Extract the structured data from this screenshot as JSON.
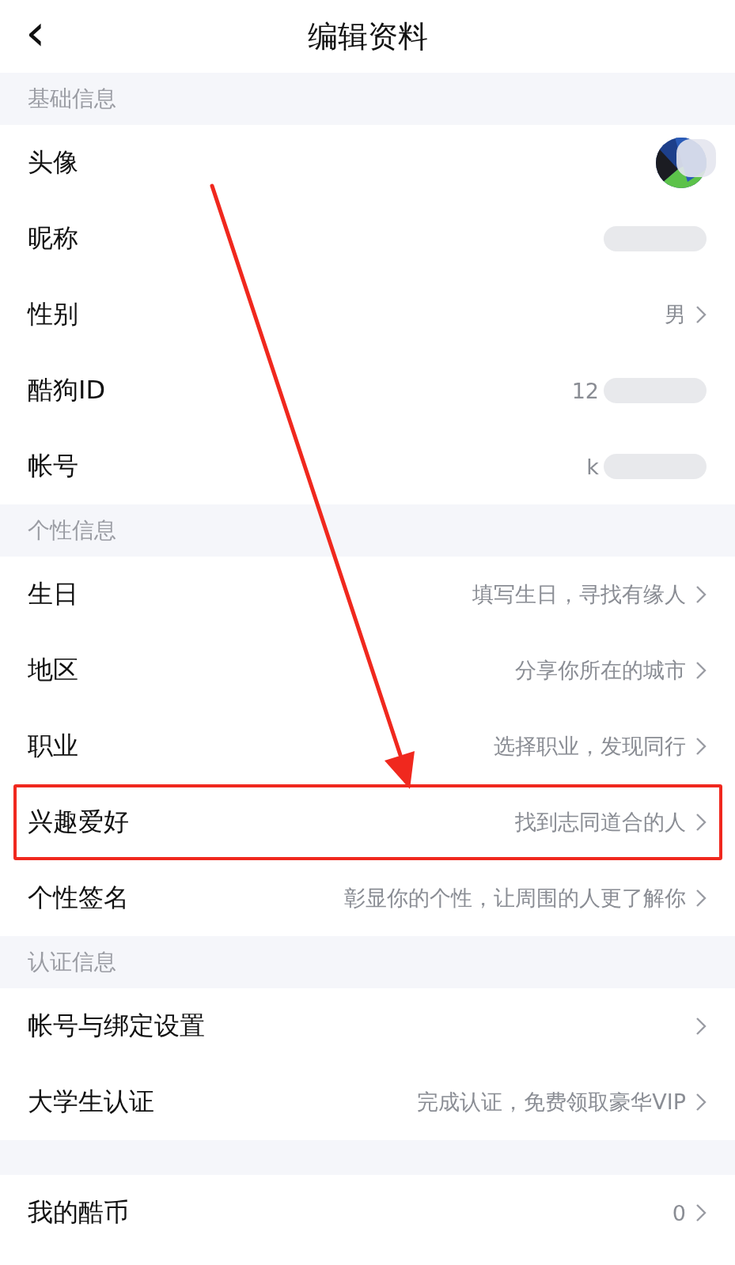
{
  "header": {
    "back_icon": "‹",
    "title": "编辑资料"
  },
  "sections": [
    {
      "title": "基础信息",
      "rows": [
        {
          "kind": "avatar",
          "label": "头像",
          "chevron": false,
          "redacted": true
        },
        {
          "kind": "value",
          "label": "昵称",
          "chevron": false,
          "redacted": true
        },
        {
          "kind": "value",
          "label": "性别",
          "value": "男",
          "chevron": true
        },
        {
          "kind": "value",
          "label": "酷狗ID",
          "value": "12",
          "chevron": false,
          "redacted": true
        },
        {
          "kind": "value",
          "label": "帐号",
          "value": "k",
          "chevron": false,
          "redacted": true
        }
      ]
    },
    {
      "title": "个性信息",
      "rows": [
        {
          "kind": "value",
          "label": "生日",
          "value": "填写生日，寻找有缘人",
          "chevron": true
        },
        {
          "kind": "value",
          "label": "地区",
          "value": "分享你所在的城市",
          "chevron": true
        },
        {
          "kind": "value",
          "label": "职业",
          "value": "选择职业，发现同行",
          "chevron": true
        },
        {
          "kind": "value",
          "label": "兴趣爱好",
          "value": "找到志同道合的人",
          "chevron": true,
          "highlighted": true
        },
        {
          "kind": "value",
          "label": "个性签名",
          "value": "彰显你的个性，让周围的人更了解你",
          "chevron": true
        }
      ]
    },
    {
      "title": "认证信息",
      "rows": [
        {
          "kind": "value",
          "label": "帐号与绑定设置",
          "chevron": true
        },
        {
          "kind": "value",
          "label": "大学生认证",
          "value": "完成认证，免费领取豪华VIP",
          "chevron": true
        }
      ]
    },
    {
      "rows": [
        {
          "kind": "value",
          "label": "我的酷币",
          "value": "0",
          "chevron": true
        }
      ]
    }
  ]
}
